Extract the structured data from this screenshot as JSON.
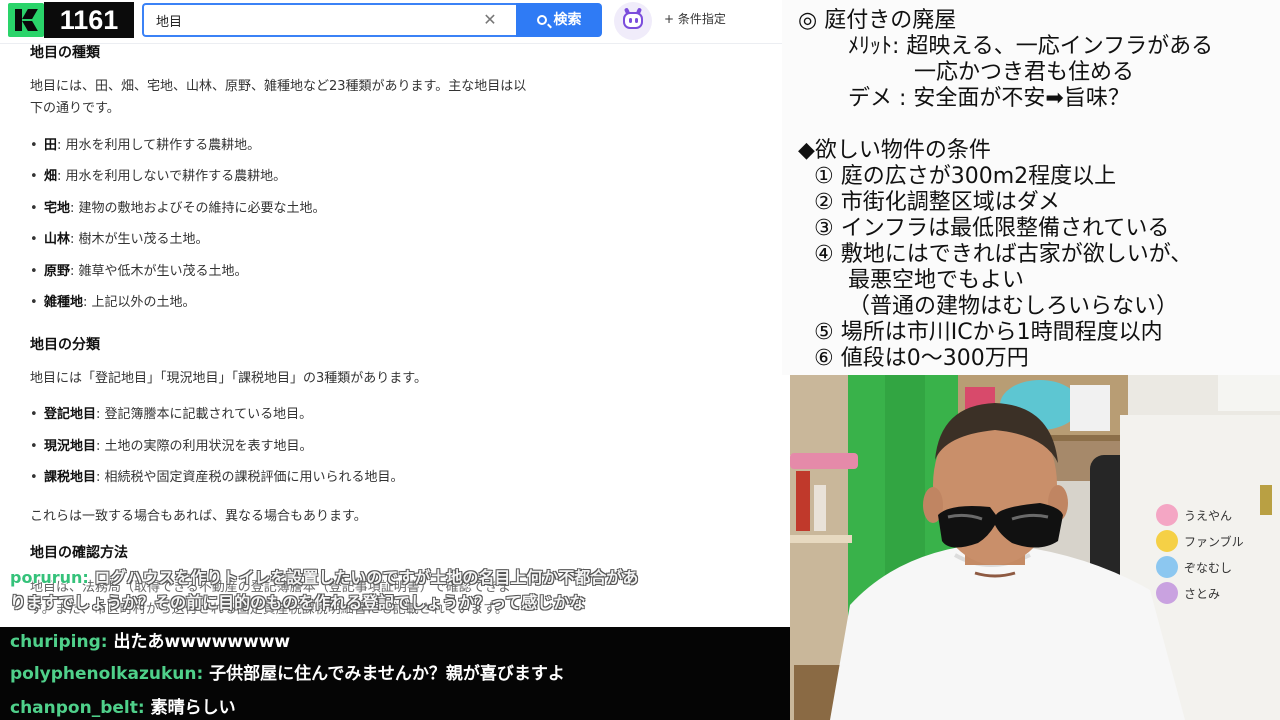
{
  "header": {
    "counter": "1161",
    "search": {
      "value": "地目"
    },
    "search_button": "検索",
    "filter_label": "+ 条件指定"
  },
  "article": {
    "heading1": "地目の種類",
    "intro_line1": "地目には、田、畑、宅地、山林、原野、雑種地など23種類があります。主な地目は以",
    "intro_line2": "下の通りです。",
    "types": [
      {
        "term": "田",
        "desc": ": 用水を利用して耕作する農耕地。"
      },
      {
        "term": "畑",
        "desc": ": 用水を利用しないで耕作する農耕地。"
      },
      {
        "term": "宅地",
        "desc": ": 建物の敷地およびその維持に必要な土地。"
      },
      {
        "term": "山林",
        "desc": ": 樹木が生い茂る土地。"
      },
      {
        "term": "原野",
        "desc": ": 雑草や低木が生い茂る土地。"
      },
      {
        "term": "雑種地",
        "desc": ": 上記以外の土地。"
      }
    ],
    "heading2": "地目の分類",
    "classification_intro": "地目には「登記地目」「現況地目」「課税地目」の3種類があります。",
    "classes": [
      {
        "term": "登記地目",
        "desc": ": 登記簿謄本に記載されている地目。"
      },
      {
        "term": "現況地目",
        "desc": ": 土地の実際の利用状況を表す地目。"
      },
      {
        "term": "課税地目",
        "desc": ": 相続税や固定資産税の課税評価に用いられる地目。"
      }
    ],
    "note": "これらは一致する場合もあれば、異なる場合もあります。",
    "heading3": "地目の確認方法",
    "hidden_line1": "地目は、法務局（取得できる不動産の登記簿謄本（登記事項証明書）で確認できま",
    "hidden_line2": "す。また、市区町村から送付される固定資産税課税明細書にも記載されています。"
  },
  "chat": {
    "overlay": {
      "user": "porurun:",
      "line1": " ログハウスを作りトイレを設置したいのですが土地の名目上何か不都合があ",
      "line2": "りますでしょうか？その前に目的のものを作れる登記でしょうか？って感じかな"
    },
    "messages": [
      {
        "user": "churiping:",
        "text": " 出たあwwwwwwww"
      },
      {
        "user": "polyphenolkazukun:",
        "text": " 子供部屋に住んでみませんか？親が喜びますよ"
      },
      {
        "user": "chanpon_belt:",
        "text": " 素晴らしい"
      }
    ]
  },
  "notes": {
    "title": "◎ 庭付きの廃屋",
    "merit_label": "ﾒﾘｯﾄ: ",
    "merit1": "超映える、一応インフラがある",
    "merit2": "一応かつき君も住める",
    "demerit_label": "デメ : ",
    "demerit": "安全面が不安➡旨味？",
    "conditions_title": "◆欲しい物件の条件",
    "conditions": [
      "① 庭の広さが300m2程度以上",
      "② 市街化調整区域はダメ",
      "③ インフラは最低限整備されている",
      "④ 敷地にはできれば古家が欲しいが、",
      "最悪空地でもよい",
      "（普通の建物はむしろいらない）",
      "⑤ 場所は市川ICから1時間程度以内",
      "⑥ 値段は0～300万円"
    ]
  },
  "webcam": {
    "shelf_labels": [
      "うえやん",
      "ファンブル",
      "ぞなむし",
      "さとみ"
    ]
  },
  "colors": {
    "accent_green": "#2ad46a",
    "search_blue": "#2f7bf5",
    "chat_user_green": "#4fd08a"
  }
}
